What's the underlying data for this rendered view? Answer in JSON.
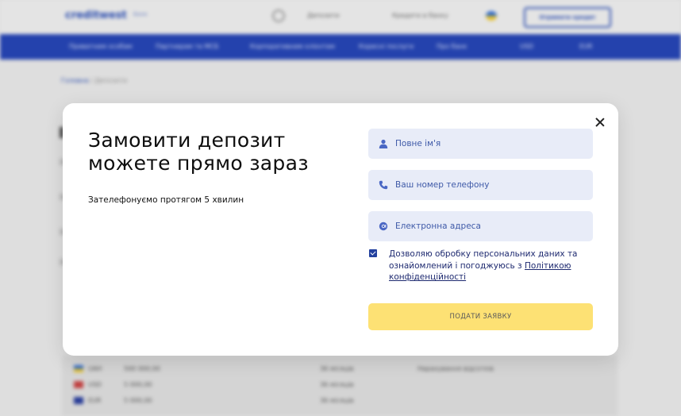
{
  "background": {
    "logo": "creditwest",
    "logo_sub": "Банк",
    "top_menu": [
      "Депозити",
      "Кредити в банку"
    ],
    "top_button": "Отримати кредит",
    "nav": [
      "Приватним особам",
      "Партнерам та МСБ",
      "Корпоративним клієнтам",
      "Корисні послуги",
      "Про банк"
    ],
    "nav_right": [
      "USD",
      "EUR"
    ],
    "breadcrumbs": {
      "home": "Головна",
      "current": "Депозити"
    },
    "table_rows": [
      {
        "currency": "UAH",
        "amount": "500 000,00",
        "term": "36 місяців",
        "note": "Нарахування відсотків"
      },
      {
        "currency": "USD",
        "amount": "5 000,00",
        "term": "36 місяців",
        "note": ""
      },
      {
        "currency": "EUR",
        "amount": "5 000,00",
        "term": "36 місяців",
        "note": ""
      }
    ]
  },
  "modal": {
    "title": "Замовити депозит можете прямо зараз",
    "subtitle": "Зателефонуємо протягом 5 хвилин",
    "fields": [
      {
        "icon": "user-icon",
        "placeholder": "Повне ім'я",
        "value": ""
      },
      {
        "icon": "phone-icon",
        "placeholder": "Ваш номер телефону",
        "value": ""
      },
      {
        "icon": "at-icon",
        "placeholder": "Електронна адреса",
        "value": ""
      }
    ],
    "consent_checked": true,
    "consent_text": "Дозволяю обробку персональних даних та ознайомлений і погоджуюсь з ",
    "consent_link": "Політикою конфіденційності",
    "submit_label": "ПОДАТИ ЗАЯВКУ"
  },
  "colors": {
    "nav_bg": "#2747b8",
    "field_bg": "#e8ecf8",
    "submit_bg": "#fde174",
    "checkbox": "#22409e"
  }
}
